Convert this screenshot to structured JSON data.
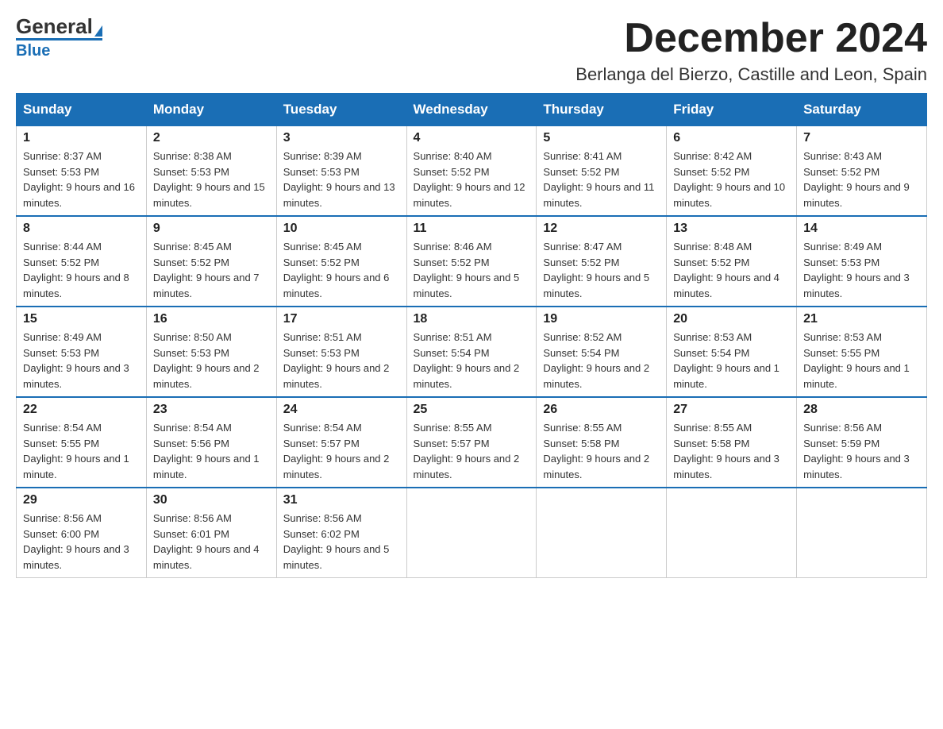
{
  "header": {
    "logo_main": "General",
    "logo_sub": "Blue",
    "title": "December 2024",
    "subtitle": "Berlanga del Bierzo, Castille and Leon, Spain"
  },
  "days_of_week": [
    "Sunday",
    "Monday",
    "Tuesday",
    "Wednesday",
    "Thursday",
    "Friday",
    "Saturday"
  ],
  "weeks": [
    [
      {
        "num": "1",
        "sunrise": "8:37 AM",
        "sunset": "5:53 PM",
        "daylight": "9 hours and 16 minutes."
      },
      {
        "num": "2",
        "sunrise": "8:38 AM",
        "sunset": "5:53 PM",
        "daylight": "9 hours and 15 minutes."
      },
      {
        "num": "3",
        "sunrise": "8:39 AM",
        "sunset": "5:53 PM",
        "daylight": "9 hours and 13 minutes."
      },
      {
        "num": "4",
        "sunrise": "8:40 AM",
        "sunset": "5:52 PM",
        "daylight": "9 hours and 12 minutes."
      },
      {
        "num": "5",
        "sunrise": "8:41 AM",
        "sunset": "5:52 PM",
        "daylight": "9 hours and 11 minutes."
      },
      {
        "num": "6",
        "sunrise": "8:42 AM",
        "sunset": "5:52 PM",
        "daylight": "9 hours and 10 minutes."
      },
      {
        "num": "7",
        "sunrise": "8:43 AM",
        "sunset": "5:52 PM",
        "daylight": "9 hours and 9 minutes."
      }
    ],
    [
      {
        "num": "8",
        "sunrise": "8:44 AM",
        "sunset": "5:52 PM",
        "daylight": "9 hours and 8 minutes."
      },
      {
        "num": "9",
        "sunrise": "8:45 AM",
        "sunset": "5:52 PM",
        "daylight": "9 hours and 7 minutes."
      },
      {
        "num": "10",
        "sunrise": "8:45 AM",
        "sunset": "5:52 PM",
        "daylight": "9 hours and 6 minutes."
      },
      {
        "num": "11",
        "sunrise": "8:46 AM",
        "sunset": "5:52 PM",
        "daylight": "9 hours and 5 minutes."
      },
      {
        "num": "12",
        "sunrise": "8:47 AM",
        "sunset": "5:52 PM",
        "daylight": "9 hours and 5 minutes."
      },
      {
        "num": "13",
        "sunrise": "8:48 AM",
        "sunset": "5:52 PM",
        "daylight": "9 hours and 4 minutes."
      },
      {
        "num": "14",
        "sunrise": "8:49 AM",
        "sunset": "5:53 PM",
        "daylight": "9 hours and 3 minutes."
      }
    ],
    [
      {
        "num": "15",
        "sunrise": "8:49 AM",
        "sunset": "5:53 PM",
        "daylight": "9 hours and 3 minutes."
      },
      {
        "num": "16",
        "sunrise": "8:50 AM",
        "sunset": "5:53 PM",
        "daylight": "9 hours and 2 minutes."
      },
      {
        "num": "17",
        "sunrise": "8:51 AM",
        "sunset": "5:53 PM",
        "daylight": "9 hours and 2 minutes."
      },
      {
        "num": "18",
        "sunrise": "8:51 AM",
        "sunset": "5:54 PM",
        "daylight": "9 hours and 2 minutes."
      },
      {
        "num": "19",
        "sunrise": "8:52 AM",
        "sunset": "5:54 PM",
        "daylight": "9 hours and 2 minutes."
      },
      {
        "num": "20",
        "sunrise": "8:53 AM",
        "sunset": "5:54 PM",
        "daylight": "9 hours and 1 minute."
      },
      {
        "num": "21",
        "sunrise": "8:53 AM",
        "sunset": "5:55 PM",
        "daylight": "9 hours and 1 minute."
      }
    ],
    [
      {
        "num": "22",
        "sunrise": "8:54 AM",
        "sunset": "5:55 PM",
        "daylight": "9 hours and 1 minute."
      },
      {
        "num": "23",
        "sunrise": "8:54 AM",
        "sunset": "5:56 PM",
        "daylight": "9 hours and 1 minute."
      },
      {
        "num": "24",
        "sunrise": "8:54 AM",
        "sunset": "5:57 PM",
        "daylight": "9 hours and 2 minutes."
      },
      {
        "num": "25",
        "sunrise": "8:55 AM",
        "sunset": "5:57 PM",
        "daylight": "9 hours and 2 minutes."
      },
      {
        "num": "26",
        "sunrise": "8:55 AM",
        "sunset": "5:58 PM",
        "daylight": "9 hours and 2 minutes."
      },
      {
        "num": "27",
        "sunrise": "8:55 AM",
        "sunset": "5:58 PM",
        "daylight": "9 hours and 3 minutes."
      },
      {
        "num": "28",
        "sunrise": "8:56 AM",
        "sunset": "5:59 PM",
        "daylight": "9 hours and 3 minutes."
      }
    ],
    [
      {
        "num": "29",
        "sunrise": "8:56 AM",
        "sunset": "6:00 PM",
        "daylight": "9 hours and 3 minutes."
      },
      {
        "num": "30",
        "sunrise": "8:56 AM",
        "sunset": "6:01 PM",
        "daylight": "9 hours and 4 minutes."
      },
      {
        "num": "31",
        "sunrise": "8:56 AM",
        "sunset": "6:02 PM",
        "daylight": "9 hours and 5 minutes."
      },
      null,
      null,
      null,
      null
    ]
  ]
}
